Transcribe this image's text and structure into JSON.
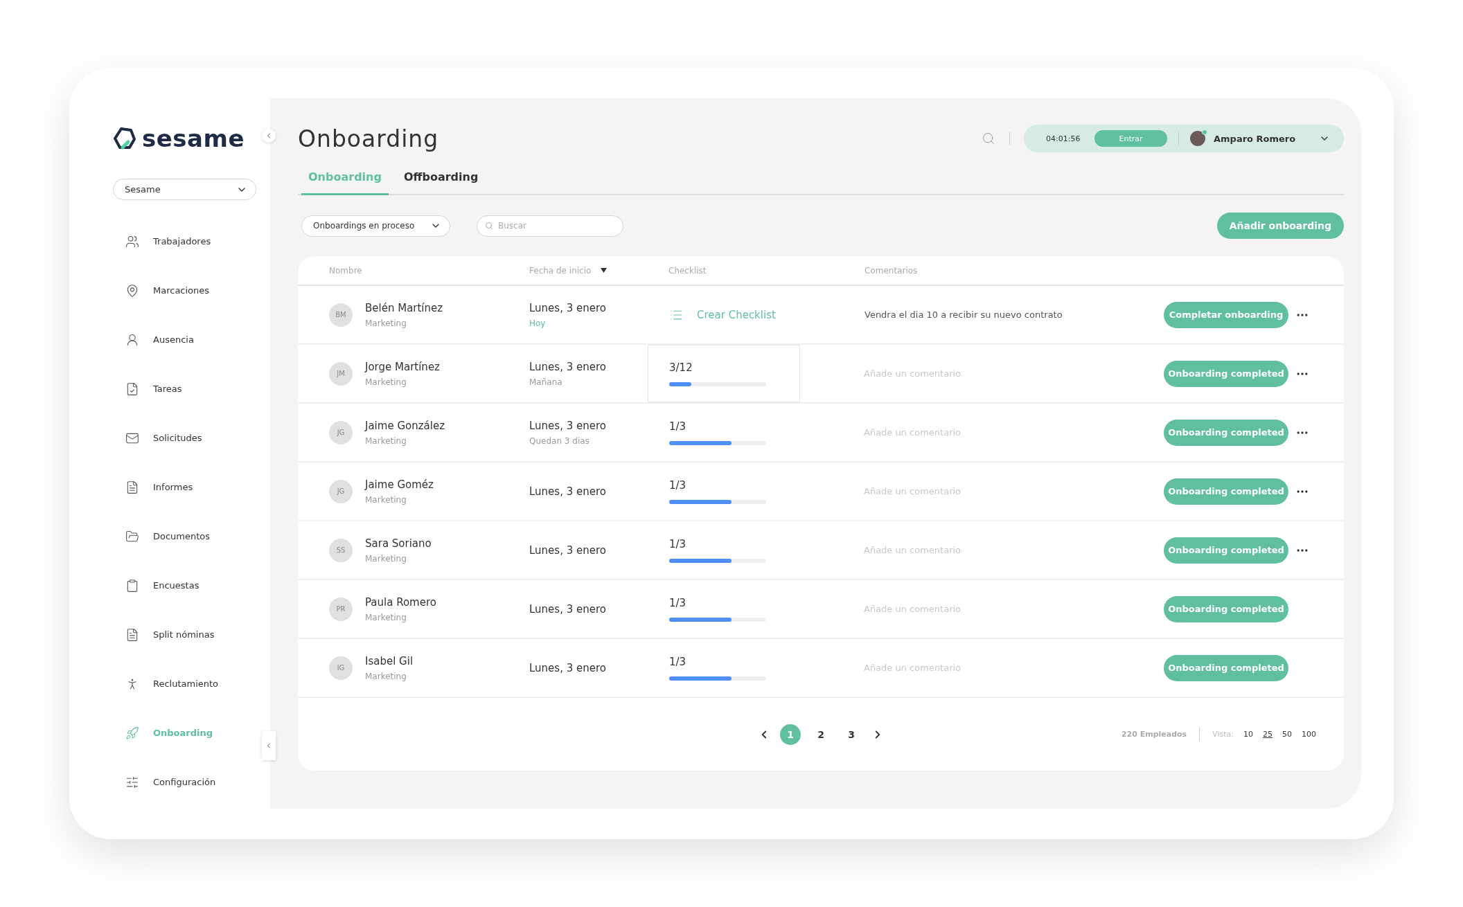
{
  "sidebar": {
    "logo": "sesame",
    "company_select": "Sesame",
    "items": [
      {
        "label": "Trabajadores",
        "selected": false
      },
      {
        "label": "Marcaciones",
        "selected": false
      },
      {
        "label": "Ausencia",
        "selected": false
      },
      {
        "label": "Tareas",
        "selected": false
      },
      {
        "label": "Solicitudes",
        "selected": false
      },
      {
        "label": "Informes",
        "selected": false
      },
      {
        "label": "Documentos",
        "selected": false
      },
      {
        "label": "Encuestas",
        "selected": false
      },
      {
        "label": "Split nóminas",
        "selected": false
      },
      {
        "label": "Reclutamiento",
        "selected": false
      },
      {
        "label": "Onboarding",
        "selected": true
      },
      {
        "label": "Configuración",
        "selected": false
      }
    ]
  },
  "header": {
    "title": "Onboarding",
    "clock": "04:01:56",
    "clock_button": "Entrar",
    "user": {
      "name": "Amparo Romero",
      "online": true
    }
  },
  "tabs": [
    {
      "label": "Onboarding",
      "selected": true
    },
    {
      "label": "Offboarding",
      "selected": false
    }
  ],
  "filters": {
    "status_select": "Onboardings en proceso",
    "search": {
      "placeholder": "Buscar"
    },
    "add_button": "Añadir onboarding"
  },
  "table": {
    "columns": [
      {
        "label": "Nombre",
        "sorted": false
      },
      {
        "label": "Fecha de inicio",
        "sorted": true
      },
      {
        "label": "Checklist",
        "sorted": false
      },
      {
        "label": "Comentarios",
        "sorted": false
      }
    ],
    "rows": [
      {
        "initials": "BM",
        "name": "Belén Martínez",
        "department": "Marketing",
        "date": "Lunes, 3 enero",
        "date_note": {
          "text": "Hoy",
          "kind": "today"
        },
        "checklist": {
          "kind": "create",
          "label": "Crear Checklist",
          "highlighted": false
        },
        "comment": {
          "value": "Vendra el dia 10 a recibir su nuevo contrato"
        },
        "action": "Completar onboarding",
        "menu": true
      },
      {
        "initials": "JM",
        "name": "Jorge Martínez",
        "department": "Marketing",
        "date": "Lunes, 3 enero",
        "date_note": {
          "text": "Mañana",
          "kind": "plain"
        },
        "checklist": {
          "kind": "progress",
          "count": "3/12",
          "level": 0.23,
          "highlighted": true
        },
        "comment": {
          "placeholder": "Añade un comentario"
        },
        "action": "Onboarding completed",
        "menu": true
      },
      {
        "initials": "JG",
        "name": "Jaime González",
        "department": "Marketing",
        "date": "Lunes, 3 enero",
        "date_note": {
          "text": "Quedan 3 dias",
          "kind": "plain"
        },
        "checklist": {
          "kind": "progress",
          "count": "1/3",
          "level": 0.64,
          "highlighted": false
        },
        "comment": {
          "placeholder": "Añade un comentario"
        },
        "action": "Onboarding completed",
        "menu": true
      },
      {
        "initials": "JG",
        "name": "Jaime Goméz",
        "department": "Marketing",
        "date": "Lunes, 3 enero",
        "checklist": {
          "kind": "progress",
          "count": "1/3",
          "level": 0.64,
          "highlighted": false
        },
        "comment": {
          "placeholder": "Añade un comentario"
        },
        "action": "Onboarding completed",
        "menu": true
      },
      {
        "initials": "SS",
        "name": "Sara Soriano",
        "department": "Marketing",
        "date": "Lunes, 3 enero",
        "checklist": {
          "kind": "progress",
          "count": "1/3",
          "level": 0.64,
          "highlighted": false
        },
        "comment": {
          "placeholder": "Añade un comentario"
        },
        "action": "Onboarding completed",
        "menu": true
      },
      {
        "initials": "PR",
        "name": "Paula Romero",
        "department": "Marketing",
        "date": "Lunes, 3 enero",
        "checklist": {
          "kind": "progress",
          "count": "1/3",
          "level": 0.64,
          "highlighted": false
        },
        "comment": {
          "placeholder": "Añade un comentario"
        },
        "action": "Onboarding completed",
        "menu": false
      },
      {
        "initials": "IG",
        "name": "Isabel Gil",
        "department": "Marketing",
        "date": "Lunes, 3 enero",
        "checklist": {
          "kind": "progress",
          "count": "1/3",
          "level": 0.64,
          "highlighted": false
        },
        "comment": {
          "placeholder": "Añade un comentario"
        },
        "action": "Onboarding completed",
        "menu": false
      }
    ]
  },
  "pagination": {
    "pages": [
      {
        "label": "1",
        "selected": true
      },
      {
        "label": "2",
        "selected": false
      },
      {
        "label": "3",
        "selected": false
      }
    ],
    "total": "220 Empleados",
    "view_label": "Vista:",
    "view_sizes": [
      {
        "label": "10",
        "selected": false
      },
      {
        "label": "25",
        "selected": true
      },
      {
        "label": "50",
        "selected": false
      },
      {
        "label": "100",
        "selected": false
      }
    ]
  }
}
